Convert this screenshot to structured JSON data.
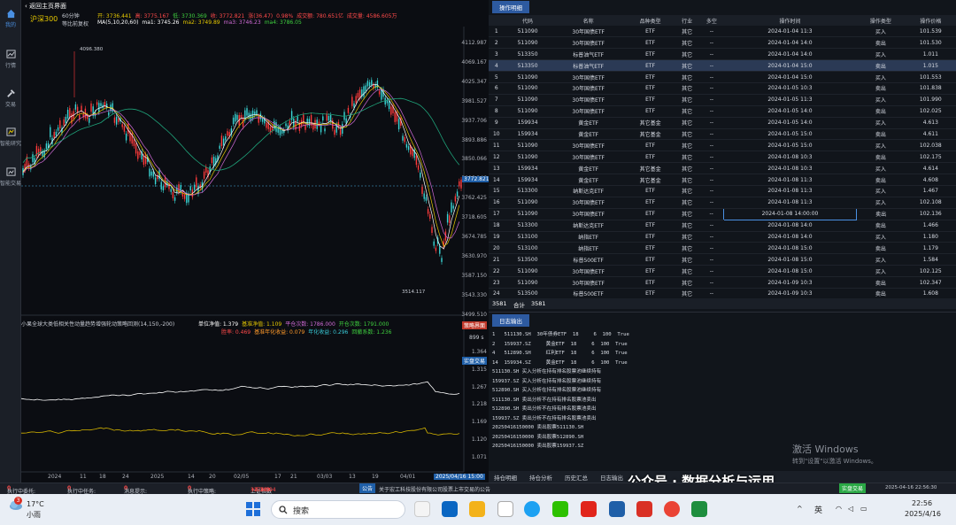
{
  "leftbar": {
    "items": [
      "我的",
      "行情",
      "交易",
      "智能研究",
      "智能交易"
    ]
  },
  "chart": {
    "back_label": "返回主页界面",
    "symbol": "沪深300",
    "period": "60分钟",
    "adjust": "等比前复权",
    "ohlc": {
      "open": "开: 3736.441",
      "high": "高: 3775.167",
      "low": "低: 3730.369",
      "close": "收: 3772.821",
      "change": "涨(36.47)",
      "pct": "0.98%",
      "amount": "成交额: 780.651亿",
      "volume": "成交量: 4586.605万"
    },
    "ma": {
      "label": "MA(5,10,20,60)",
      "ma1": "ma1: 3745.26",
      "ma2": "ma2: 3749.89",
      "ma3": "ma3: 3746.23",
      "ma4": "ma4: 3786.05"
    },
    "peak_label": "4096.380",
    "trough_label": "3514.117",
    "y_ticks": [
      "4112.987",
      "4069.167",
      "4025.347",
      "3981.527",
      "3937.706",
      "3893.886",
      "3850.066",
      "3806.246",
      "3762.425",
      "3718.605",
      "3674.785",
      "3630.970",
      "3587.150",
      "3543.330",
      "3499.510"
    ],
    "current_price": "3772.821",
    "strategy": {
      "title": "小果全球大类低相关性动量趋势增强轮动策略回测(14,150,-200)",
      "unit_nav": "单位净值: 1.379",
      "bench_nav": "基准净值: 1.109",
      "open_count": "平仓次数: 1786.000",
      "close_count": "开仓次数: 1791.000",
      "win_rate": "胜率: 0.469",
      "bench_annual": "基准年化收益: 0.079",
      "annual": "年化收益: 0.296",
      "sharpe": "回撤系数: 1.236"
    },
    "lower_ticks": [
      "1.364",
      "1.315",
      "1.267",
      "1.218",
      "1.169",
      "1.120",
      "1.071"
    ],
    "lower_badge_top": "899 s",
    "right_tags": {
      "tag1": "策略界面",
      "tag2": "实盘交易"
    },
    "x_ticks": [
      "2024",
      "11",
      "18",
      "24",
      "2025",
      "14",
      "20",
      "02/05",
      "17",
      "21",
      "03/03",
      "13",
      "19",
      "04/01"
    ],
    "x_current": "2025/04/16 15:00"
  },
  "table": {
    "tab_label": "操作明细",
    "columns": [
      "",
      "代码",
      "名称",
      "品种类型",
      "行业",
      "多空",
      "操作时间",
      "操作类型",
      "操作价格"
    ],
    "rows": [
      [
        "1",
        "511090",
        "30年国债ETF",
        "ETF",
        "其它",
        "--",
        "2024-01-04 11:3",
        "买入",
        "101.539"
      ],
      [
        "2",
        "511090",
        "30年国债ETF",
        "ETF",
        "其它",
        "--",
        "2024-01-04 14:0",
        "卖出",
        "101.530"
      ],
      [
        "3",
        "513350",
        "标普油气ETF",
        "ETF",
        "其它",
        "--",
        "2024-01-04 14:0",
        "买入",
        "1.011"
      ],
      [
        "4",
        "513350",
        "标普油气ETF",
        "ETF",
        "其它",
        "--",
        "2024-01-04 15:0",
        "卖出",
        "1.015"
      ],
      [
        "5",
        "511090",
        "30年国债ETF",
        "ETF",
        "其它",
        "--",
        "2024-01-04 15:0",
        "买入",
        "101.553"
      ],
      [
        "6",
        "511090",
        "30年国债ETF",
        "ETF",
        "其它",
        "--",
        "2024-01-05 10:3",
        "卖出",
        "101.838"
      ],
      [
        "7",
        "511090",
        "30年国债ETF",
        "ETF",
        "其它",
        "--",
        "2024-01-05 11:3",
        "买入",
        "101.990"
      ],
      [
        "8",
        "511090",
        "30年国债ETF",
        "ETF",
        "其它",
        "--",
        "2024-01-05 14:0",
        "卖出",
        "102.025"
      ],
      [
        "9",
        "159934",
        "黄金ETF",
        "其它基金",
        "其它",
        "--",
        "2024-01-05 14:0",
        "买入",
        "4.613"
      ],
      [
        "10",
        "159934",
        "黄金ETF",
        "其它基金",
        "其它",
        "--",
        "2024-01-05 15:0",
        "卖出",
        "4.611"
      ],
      [
        "11",
        "511090",
        "30年国债ETF",
        "ETF",
        "其它",
        "--",
        "2024-01-05 15:0",
        "买入",
        "102.038"
      ],
      [
        "12",
        "511090",
        "30年国债ETF",
        "ETF",
        "其它",
        "--",
        "2024-01-08 10:3",
        "卖出",
        "102.175"
      ],
      [
        "13",
        "159934",
        "黄金ETF",
        "其它基金",
        "其它",
        "--",
        "2024-01-08 10:3",
        "买入",
        "4.614"
      ],
      [
        "14",
        "159934",
        "黄金ETF",
        "其它基金",
        "其它",
        "--",
        "2024-01-08 11:3",
        "卖出",
        "4.608"
      ],
      [
        "15",
        "513300",
        "纳斯达克ETF",
        "ETF",
        "其它",
        "--",
        "2024-01-08 11:3",
        "买入",
        "1.467"
      ],
      [
        "16",
        "511090",
        "30年国债ETF",
        "ETF",
        "其它",
        "--",
        "2024-01-08 11:3",
        "买入",
        "102.108"
      ],
      [
        "17",
        "511090",
        "30年国债ETF",
        "ETF",
        "其它",
        "--",
        "2024-01-08 14:00:00",
        "卖出",
        "102.136"
      ],
      [
        "18",
        "513300",
        "纳斯达克ETF",
        "ETF",
        "其它",
        "--",
        "2024-01-08 14:0",
        "卖出",
        "1.466"
      ],
      [
        "19",
        "513100",
        "纳指ETF",
        "ETF",
        "其它",
        "--",
        "2024-01-08 14:0",
        "买入",
        "1.180"
      ],
      [
        "20",
        "513100",
        "纳指ETF",
        "ETF",
        "其它",
        "--",
        "2024-01-08 15:0",
        "卖出",
        "1.179"
      ],
      [
        "21",
        "513500",
        "标普500ETF",
        "ETF",
        "其它",
        "--",
        "2024-01-08 15:0",
        "买入",
        "1.584"
      ],
      [
        "22",
        "511090",
        "30年国债ETF",
        "ETF",
        "其它",
        "--",
        "2024-01-08 15:0",
        "买入",
        "102.125"
      ],
      [
        "23",
        "511090",
        "30年国债ETF",
        "ETF",
        "其它",
        "--",
        "2024-01-09 10:3",
        "卖出",
        "102.347"
      ],
      [
        "24",
        "513500",
        "标普500ETF",
        "ETF",
        "其它",
        "--",
        "2024-01-09 10:3",
        "卖出",
        "1.608"
      ]
    ],
    "footer": {
      "count_a": "3581",
      "total_label": "合计",
      "count_b": "3581"
    }
  },
  "log": {
    "tab_label": "日志输出",
    "lines": [
      "1   511130.SH  30年债券ETF  18     6  100  True",
      "2   159937.SZ     黄金ETF  18     6  100  True",
      "4   512890.SH     红利ETF  18     6  100  True",
      "14  159934.SZ     黄金ETF  18     6  100  True",
      "511130.SH 买入分析在持有排名股票池继续持有",
      "159937.SZ 买入分析在持有排名股票池继续持有",
      "512890.SH 买入分析在持有排名股票池继续持有",
      "511130.SH 卖出分析不在持有排名股票池卖出",
      "512890.SH 卖出分析不在持有排名股票池卖出",
      "159937.SZ 卖出分析不在持有排名股票池卖出",
      "20250416150000 卖出股票511130.SH",
      "20250416150000 卖出股票512890.SH",
      "20250416150000 卖出股票159937.SZ"
    ],
    "bottom_tabs": [
      "持仓明细",
      "持仓分析",
      "历史汇总",
      "日志输出"
    ],
    "watermark1": "激活 Windows",
    "watermark2": "转到\"设置\"以激活 Windows。",
    "wechat": "公众号 · 数据分析与运用"
  },
  "status": {
    "exec_msg": "执行中委托:",
    "exec_msg_v": "0",
    "exec_task": "执行中任务:",
    "exec_task_v": "0",
    "msg": "消息提示:",
    "msg_v": "0",
    "exec_strategy": "执行中策略:",
    "exec_strategy_v": "0",
    "index": "上证指数",
    "index_v": "3276.004",
    "index_chg": "+6.342",
    "index_pct": "+0.20%",
    "notice_tag": "公告",
    "notice": "关于宏工科技股份有限公司股票上市交易的公告",
    "right_btn": "实盘交易",
    "datetime": "2025-04-16 22:56:30"
  },
  "taskbar": {
    "weather_badge": "3",
    "temp": "17°C",
    "weather": "小雨",
    "search": "搜索",
    "lang": "英",
    "time": "22:56",
    "date": "2025/4/16"
  }
}
